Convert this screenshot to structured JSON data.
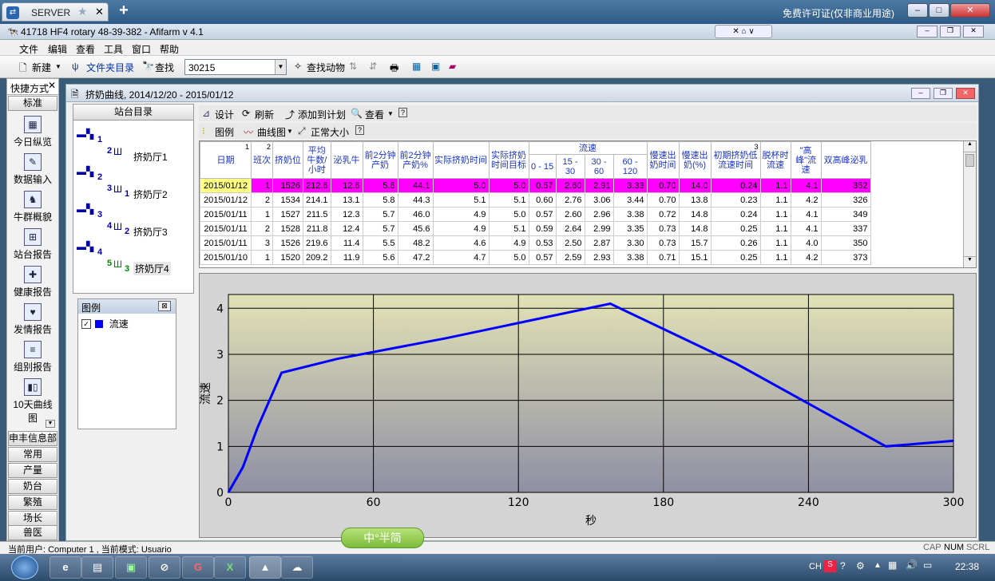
{
  "remote": {
    "tab_label": "SERVER",
    "license_text": "免费许可证(仅非商业用途)"
  },
  "app": {
    "title": "41718 HF4 rotary 48-39-382 - Afifarm v 4.1"
  },
  "menu": [
    "文件",
    "编辑",
    "查看",
    "工具",
    "窗口",
    "帮助"
  ],
  "toolbar": {
    "new_label": "新建",
    "folder_label": "文件夹目录",
    "find_label": "查找",
    "search_value": "30215",
    "find_animal_label": "查找动物"
  },
  "shortcuts": {
    "header": "快捷方式",
    "top_button": "标准",
    "items": [
      {
        "label": "今日纵览",
        "icon": "calendar-icon"
      },
      {
        "label": "数据输入",
        "icon": "data-entry-icon"
      },
      {
        "label": "牛群概貌",
        "icon": "herd-icon"
      },
      {
        "label": "站台报告",
        "icon": "station-report-icon"
      },
      {
        "label": "健康报告",
        "icon": "health-icon"
      },
      {
        "label": "发情报告",
        "icon": "heat-icon"
      },
      {
        "label": "组别报告",
        "icon": "group-report-icon"
      },
      {
        "label": "10天曲线图",
        "icon": "curve-chart-icon"
      }
    ],
    "bottom_buttons": [
      "申丰信息部",
      "常用",
      "产量",
      "奶台",
      "繁殖",
      "场长",
      "兽医"
    ]
  },
  "doc": {
    "title": "挤奶曲线, 2014/12/20 - 2015/01/12",
    "tree_header": "站台目录",
    "tree_nodes": [
      {
        "badge_top": "1",
        "badge_sub": "2",
        "label": "挤奶厅1"
      },
      {
        "badge_top": "2",
        "badge_sub": "3",
        "badge_sub2": "1",
        "label": "挤奶厅2"
      },
      {
        "badge_top": "3",
        "badge_sub": "4",
        "badge_sub2": "2",
        "label": "挤奶厅3"
      },
      {
        "badge_top": "4",
        "badge_sub": "5",
        "badge_sub2": "3",
        "label": "挤奶厅4"
      }
    ],
    "legend_title": "图例",
    "legend_item": "流速",
    "legend_color": "#0000ff",
    "tb2": {
      "design": "设计",
      "refresh": "刷新",
      "add_plan": "添加到计划",
      "view": "查看"
    },
    "tb3": {
      "legend": "图例",
      "curve": "曲线图",
      "normal_size": "正常大小"
    }
  },
  "table": {
    "headers": {
      "date": "日期",
      "shift": "班次",
      "stall": "挤奶位",
      "avg_cows": "平均牛数/小时",
      "lact": "泌乳牛",
      "y2": "前2分钟产奶",
      "y2p": "前2分钟产奶%",
      "actual_time": "实际挤奶时间",
      "target": "实际挤奶时间目标",
      "flow_group": "流速",
      "f1": "0 - 15",
      "f2": "15 - 30",
      "f3": "30 - 60",
      "f4": "60 - 120",
      "slow_time": "慢速出奶时间",
      "slow_pct": "慢速出奶(%)",
      "init_low": "初期挤奶低流速时间",
      "detach": "脱杯时流速",
      "peak": "\"高峰\"流速",
      "dbl": "双高峰泌乳",
      "sort1": "1",
      "sort2": "2",
      "sort3": "3"
    },
    "rows": [
      [
        "2015/01/12",
        "1",
        "1526",
        "212.6",
        "12.6",
        "5.6",
        "44.1",
        "5.0",
        "5.0",
        "0.57",
        "2.60",
        "2.91",
        "3.33",
        "0.70",
        "14.0",
        "0.24",
        "1.1",
        "4.1",
        "352"
      ],
      [
        "2015/01/12",
        "2",
        "1534",
        "214.1",
        "13.1",
        "5.8",
        "44.3",
        "5.1",
        "5.1",
        "0.60",
        "2.76",
        "3.06",
        "3.44",
        "0.70",
        "13.8",
        "0.23",
        "1.1",
        "4.2",
        "326"
      ],
      [
        "2015/01/11",
        "1",
        "1527",
        "211.5",
        "12.3",
        "5.7",
        "46.0",
        "4.9",
        "5.0",
        "0.57",
        "2.60",
        "2.96",
        "3.38",
        "0.72",
        "14.8",
        "0.24",
        "1.1",
        "4.1",
        "349"
      ],
      [
        "2015/01/11",
        "2",
        "1528",
        "211.8",
        "12.4",
        "5.7",
        "45.6",
        "4.9",
        "5.1",
        "0.59",
        "2.64",
        "2.99",
        "3.35",
        "0.73",
        "14.8",
        "0.25",
        "1.1",
        "4.1",
        "337"
      ],
      [
        "2015/01/11",
        "3",
        "1526",
        "219.6",
        "11.4",
        "5.5",
        "48.2",
        "4.6",
        "4.9",
        "0.53",
        "2.50",
        "2.87",
        "3.30",
        "0.73",
        "15.7",
        "0.26",
        "1.1",
        "4.0",
        "350"
      ],
      [
        "2015/01/10",
        "1",
        "1520",
        "209.2",
        "11.9",
        "5.6",
        "47.2",
        "4.7",
        "5.0",
        "0.57",
        "2.59",
        "2.93",
        "3.38",
        "0.71",
        "15.1",
        "0.25",
        "1.1",
        "4.2",
        "373"
      ]
    ]
  },
  "chart_data": {
    "type": "line",
    "title": "",
    "xlabel": "秒",
    "ylabel": "流速",
    "xlim": [
      0,
      300
    ],
    "ylim": [
      0,
      4.3
    ],
    "xticks": [
      0,
      60,
      120,
      180,
      240,
      300
    ],
    "yticks": [
      0,
      1,
      2,
      3,
      4
    ],
    "grid": true,
    "series": [
      {
        "name": "流速",
        "color": "#0000ff",
        "x": [
          0,
          6,
          12,
          22,
          45,
          90,
          158,
          210,
          272,
          300
        ],
        "y": [
          0,
          0.55,
          1.4,
          2.6,
          2.9,
          3.35,
          4.1,
          2.8,
          1.0,
          1.12
        ]
      }
    ]
  },
  "status": {
    "user": "当前用户: Computer 1 , 当前模式: Usuario",
    "cap": "CAP",
    "num": "NUM",
    "scrl": "SCRL"
  },
  "ime": {
    "label": "中°半简"
  },
  "taskbar": {
    "lang": "CH",
    "clock": "22:38"
  }
}
